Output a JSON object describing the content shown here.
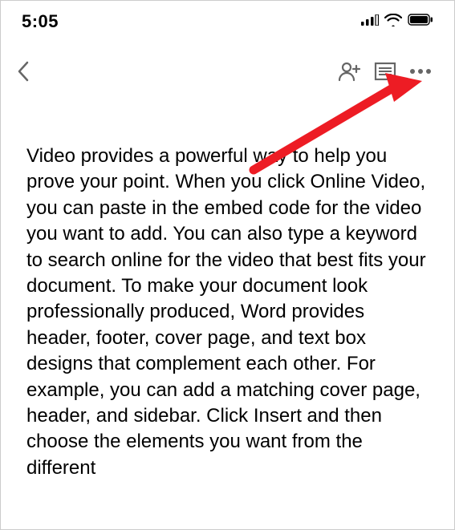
{
  "status": {
    "time": "5:05"
  },
  "document": {
    "body": "Video provides a powerful way to help you prove your point. When you click Online Video, you can paste in the embed code for the video you want to add. You can also type a keyword to search online for the video that best fits your document. To make your document look professionally produced, Word provides header, footer, cover page, and text box designs that complement each other. For example, you can add a matching cover page, header, and sidebar. Click Insert and then choose the elements you want from the different "
  },
  "annotation": {
    "arrow_color": "#ed1c24"
  }
}
